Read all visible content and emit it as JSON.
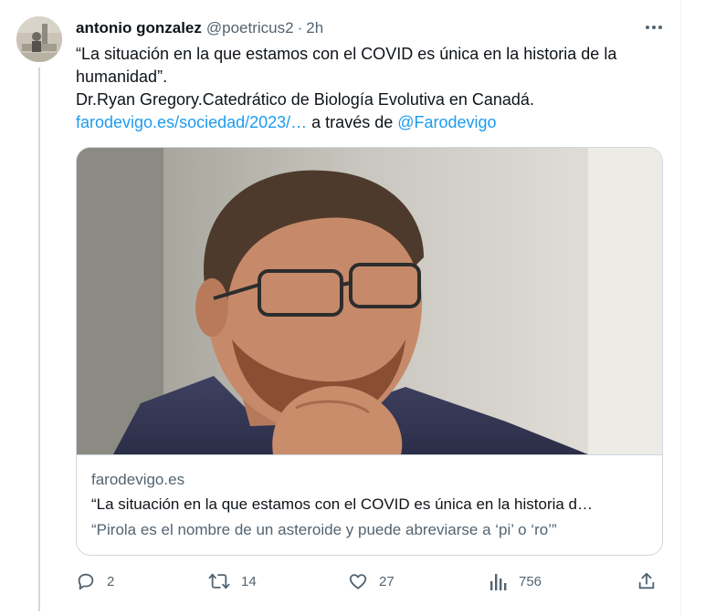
{
  "tweet": {
    "display_name": "antonio gonzalez",
    "handle": "@poetricus2",
    "separator": "·",
    "time": "2h",
    "text_line1": "“La situación en la que estamos con el COVID es única en la historia de la humanidad”.",
    "text_line2": "Dr.Ryan Gregory.Catedrático de Biología Evolutiva en Canadá.",
    "link_text": "farodevigo.es/sociedad/2023/…",
    "via_text": " a través de ",
    "mention": "@Farodevigo"
  },
  "card": {
    "domain": "farodevigo.es",
    "title": "“La situación en la que estamos con el COVID es única en la historia d…",
    "description": "“Pirola es el nombre de un asteroide y puede abreviarse a ‘pi’ o ‘ro’”"
  },
  "actions": {
    "replies": "2",
    "retweets": "14",
    "likes": "27",
    "views": "756"
  },
  "icons": {
    "more": "more-icon",
    "reply": "reply-icon",
    "retweet": "retweet-icon",
    "like": "heart-icon",
    "views": "views-icon",
    "share": "share-icon"
  },
  "colors": {
    "link": "#1d9bf0",
    "secondary_text": "#536471",
    "primary_text": "#0f1419",
    "border": "#cfd9de"
  }
}
